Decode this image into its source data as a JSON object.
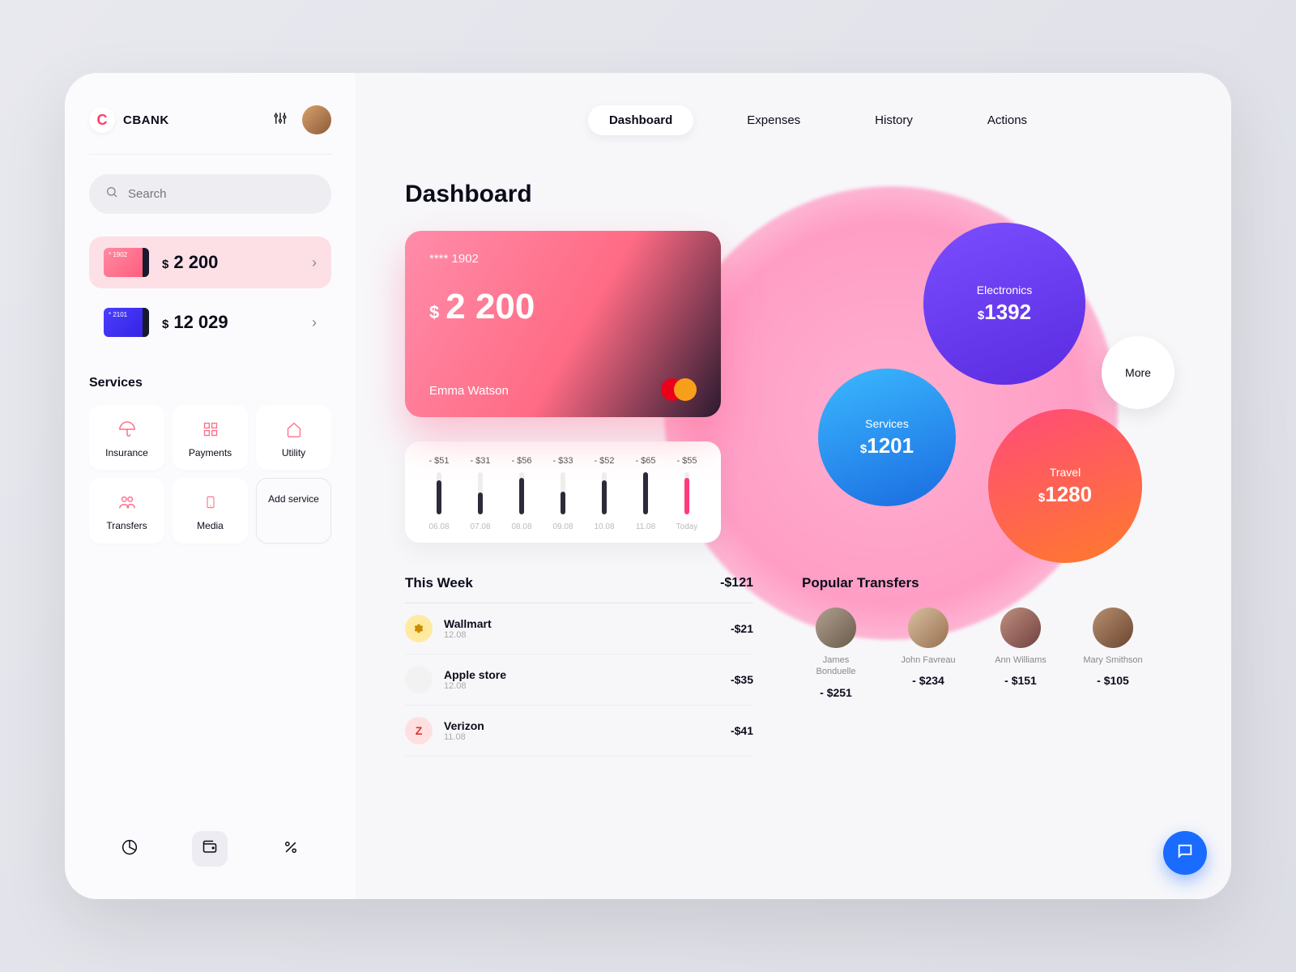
{
  "brand": {
    "letter": "C",
    "name": "CBANK"
  },
  "search": {
    "placeholder": "Search"
  },
  "cards": [
    {
      "last4": "* 1902",
      "balance": "2 200",
      "currency": "$"
    },
    {
      "last4": "* 2101",
      "balance": "12 029",
      "currency": "$"
    }
  ],
  "services": {
    "title": "Services",
    "items": [
      "Insurance",
      "Payments",
      "Utility",
      "Transfers",
      "Media"
    ],
    "add": "Add service"
  },
  "tabs": [
    "Dashboard",
    "Expenses",
    "History",
    "Actions"
  ],
  "page_title": "Dashboard",
  "credit_card": {
    "masked": "**** 1902",
    "currency": "$",
    "balance": "2 200",
    "holder": "Emma Watson"
  },
  "chart_data": {
    "type": "bar",
    "title": "",
    "categories": [
      "06.08",
      "07.08",
      "08.08",
      "09.08",
      "10.08",
      "11.08",
      "Today"
    ],
    "values": [
      -51,
      -31,
      -56,
      -33,
      -52,
      -65,
      -55
    ],
    "value_labels": [
      "- $51",
      "- $31",
      "- $56",
      "- $33",
      "- $52",
      "- $65",
      "- $55"
    ],
    "ylim": [
      -70,
      0
    ]
  },
  "bubbles": {
    "electronics": {
      "label": "Electronics",
      "currency": "$",
      "amount": "1392"
    },
    "services": {
      "label": "Services",
      "currency": "$",
      "amount": "1201"
    },
    "travel": {
      "label": "Travel",
      "currency": "$",
      "amount": "1280"
    },
    "more": "More"
  },
  "week": {
    "title": "This Week",
    "total": "-$121",
    "items": [
      {
        "name": "Wallmart",
        "date": "12.08",
        "amount": "-$21",
        "icon": "✽"
      },
      {
        "name": "Apple store",
        "date": "12.08",
        "amount": "-$35",
        "icon": ""
      },
      {
        "name": "Verizon",
        "date": "11.08",
        "amount": "-$41",
        "icon": "Z"
      }
    ]
  },
  "transfers": {
    "title": "Popular Transfers",
    "people": [
      {
        "name": "James Bonduelle",
        "amount": "- $251"
      },
      {
        "name": "John Favreau",
        "amount": "- $234"
      },
      {
        "name": "Ann Williams",
        "amount": "- $151"
      },
      {
        "name": "Mary Smithson",
        "amount": "- $105"
      }
    ]
  }
}
